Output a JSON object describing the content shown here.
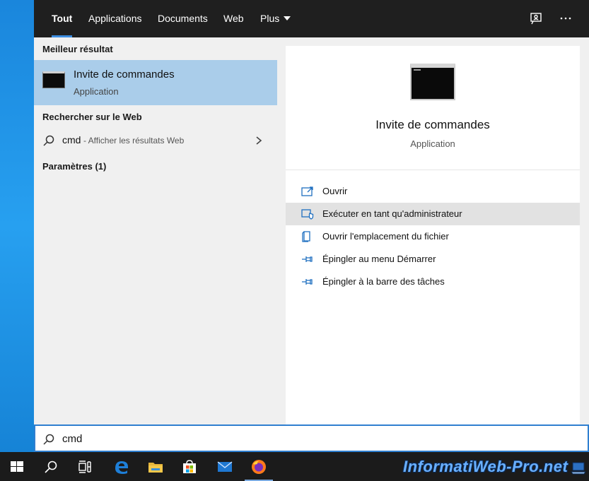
{
  "tabs": [
    {
      "label": "Tout",
      "active": true
    },
    {
      "label": "Applications"
    },
    {
      "label": "Documents"
    },
    {
      "label": "Web"
    },
    {
      "label": "Plus"
    }
  ],
  "topbar_icons": [
    "feedback-icon",
    "more-options-icon"
  ],
  "left": {
    "best_match_header": "Meilleur résultat",
    "best_match": {
      "title": "Invite de commandes",
      "subtitle": "Application",
      "icon": "command-prompt-icon"
    },
    "web_header": "Rechercher sur le Web",
    "web_result": {
      "query": "cmd",
      "hint": "- Afficher les résultats Web"
    },
    "settings_header": "Paramètres (1)"
  },
  "preview": {
    "title": "Invite de commandes",
    "subtitle": "Application",
    "icon": "command-prompt-icon"
  },
  "actions": [
    {
      "label": "Ouvrir",
      "icon": "open-icon"
    },
    {
      "label": "Exécuter en tant qu'administrateur",
      "icon": "run-as-admin-icon",
      "hovered": true
    },
    {
      "label": "Ouvrir l'emplacement du fichier",
      "icon": "file-location-icon"
    },
    {
      "label": "Épingler au menu Démarrer",
      "icon": "pin-icon"
    },
    {
      "label": "Épingler à la barre des tâches",
      "icon": "pin-icon"
    }
  ],
  "search": {
    "value": "cmd",
    "placeholder": ""
  },
  "taskbar": [
    "windows-start-icon",
    "search-icon",
    "task-view-icon",
    "edge-icon",
    "file-explorer-icon",
    "store-icon",
    "mail-icon",
    "firefox-icon"
  ],
  "watermark": "InformatiWeb-Pro.net",
  "colors": {
    "accent": "#2f7fd0",
    "selection": "#aacdea",
    "icon_blue": "#1f6fc0",
    "topbar": "#1f1f1f"
  }
}
